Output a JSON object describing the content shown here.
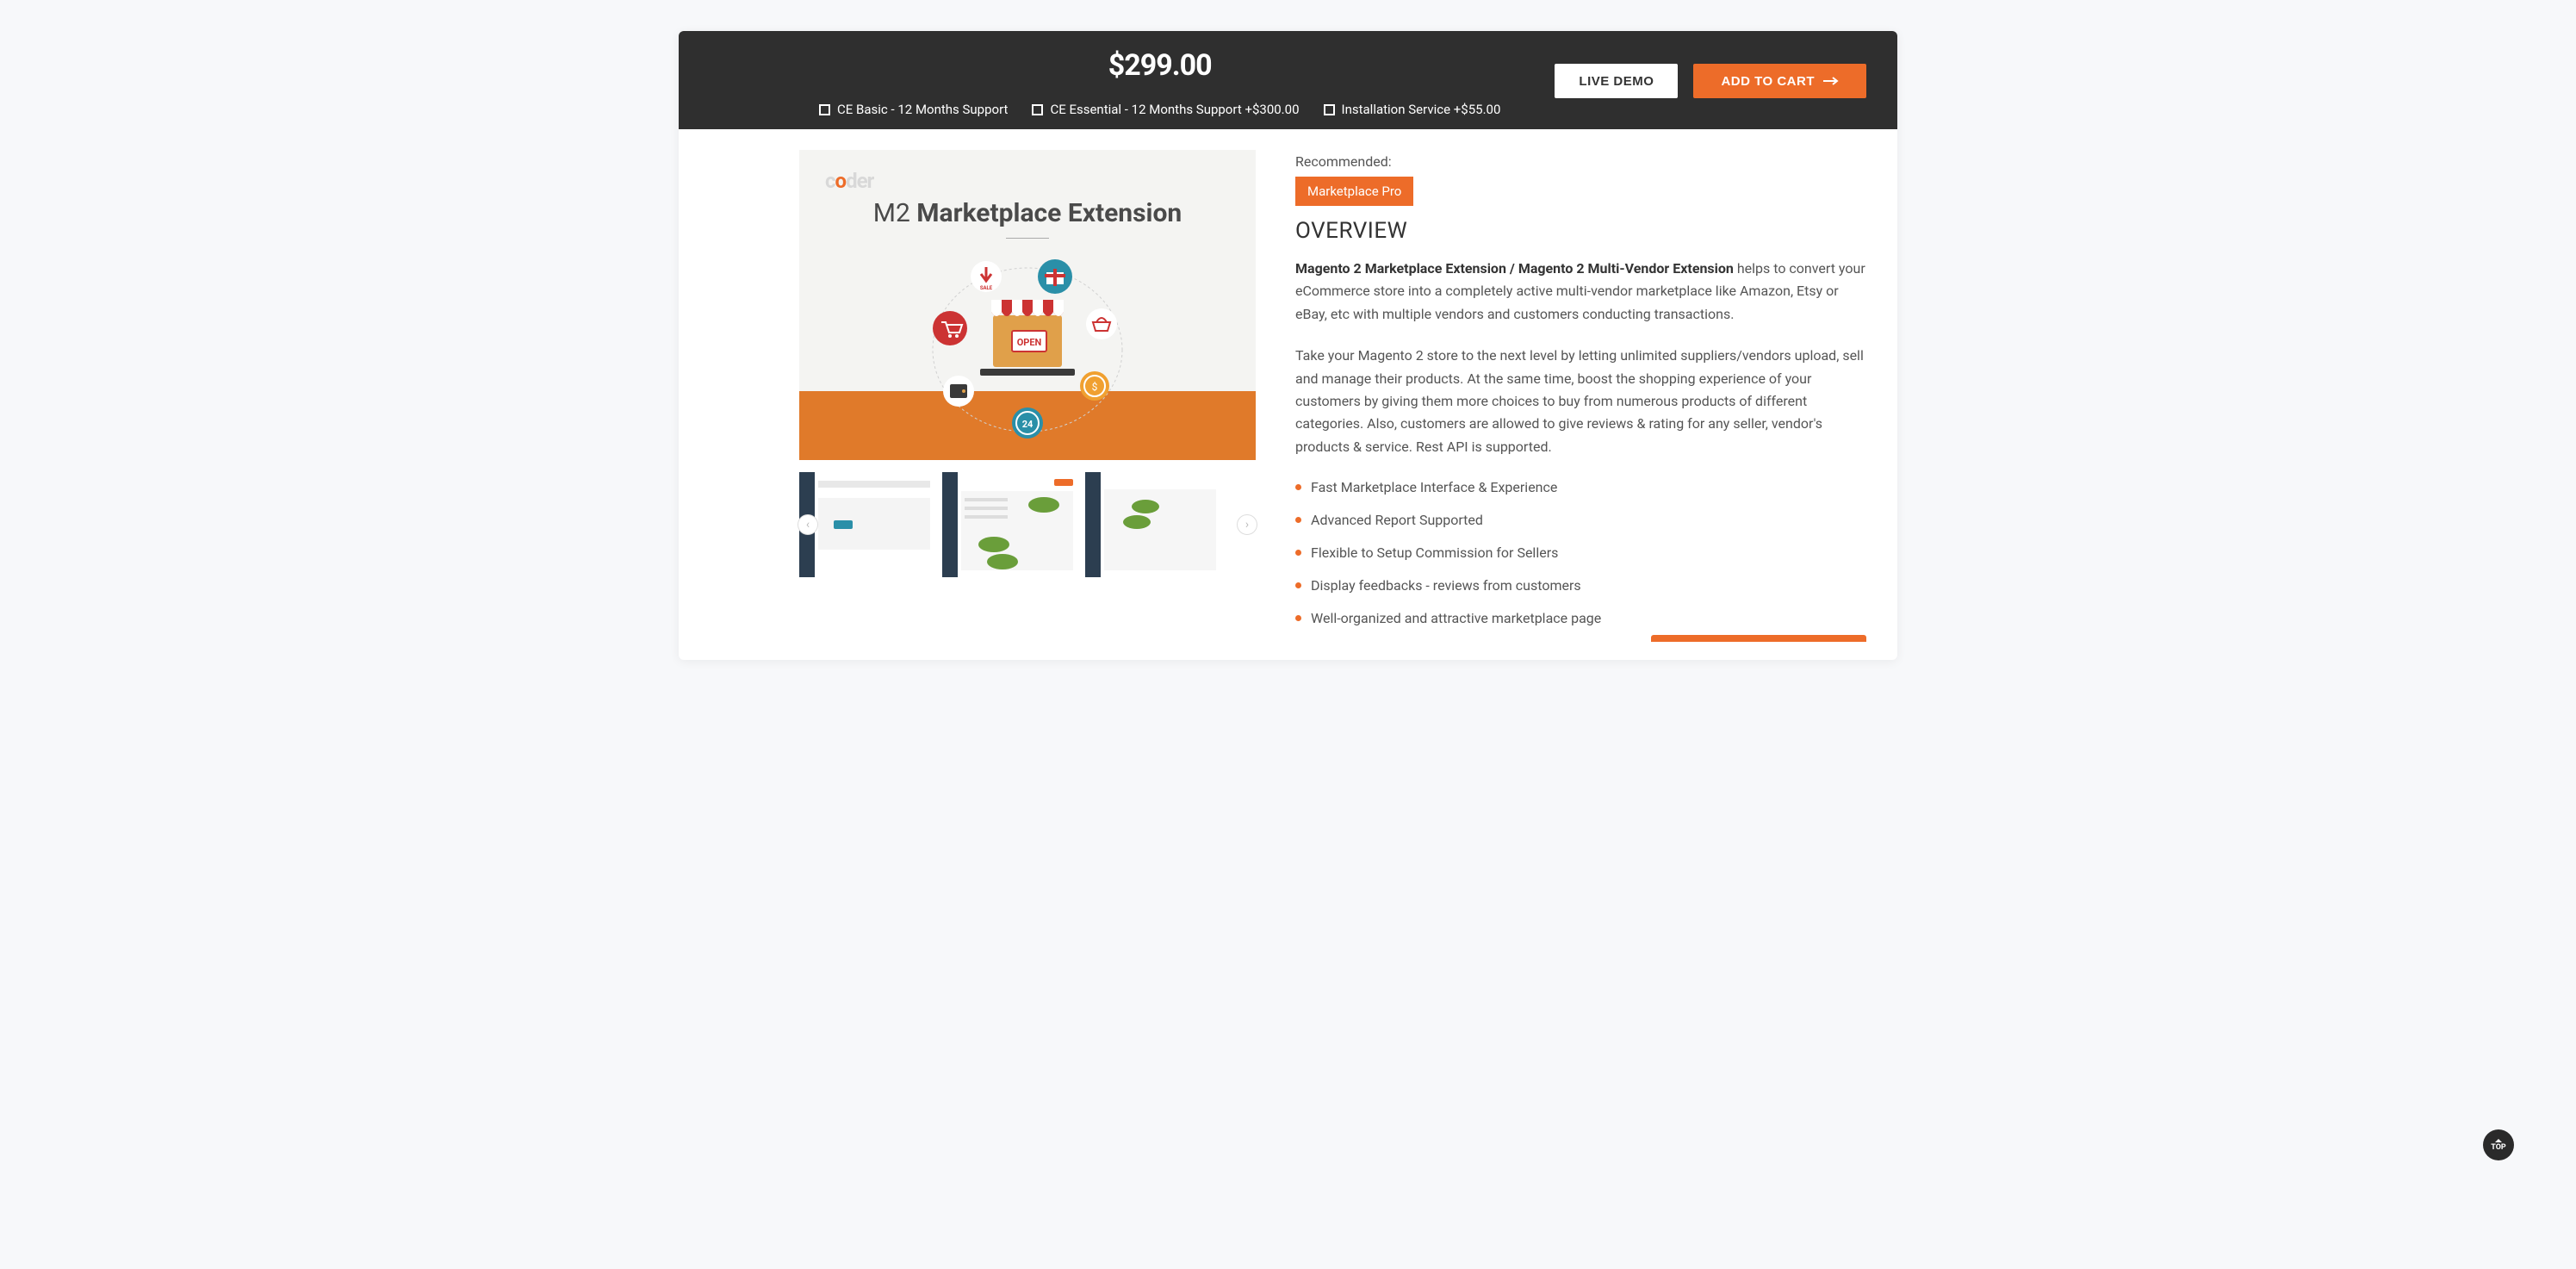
{
  "topbar": {
    "price": "$299.00",
    "options": [
      {
        "label": "CE Basic - 12 Months Support",
        "extra": ""
      },
      {
        "label": "CE Essential - 12 Months Support ",
        "extra": "+$300.00"
      },
      {
        "label": "Installation Service ",
        "extra": "+$55.00"
      }
    ],
    "live_demo": "LIVE DEMO",
    "add_to_cart": "ADD TO CART"
  },
  "hero": {
    "logo_prefix": "c",
    "logo_o": "o",
    "logo_suffix": "der",
    "title_light": "M2 ",
    "title_bold": "Marketplace Extension",
    "open_text": "OPEN",
    "sale_text": "SALE",
    "badge_text": "24"
  },
  "details": {
    "recommended_label": "Recommended:",
    "recommended_pill": "Marketplace Pro",
    "overview_heading": "OVERVIEW",
    "lead_strong": "Magento 2 Marketplace Extension / Magento 2 Multi-Vendor Extension",
    "lead_rest": " helps to convert your eCommerce store into a completely active multi-vendor marketplace like Amazon, Etsy or eBay, etc with multiple vendors and customers conducting transactions.",
    "para2": "Take your Magento 2 store to the next level by letting unlimited suppliers/vendors upload, sell and manage their products. At the same time, boost the shopping experience of your customers by giving them more choices to buy from numerous products of different categories. Also, customers are allowed to give reviews & rating for any seller, vendor's products & service. Rest API is supported.",
    "bullets": [
      "Fast Marketplace Interface & Experience",
      "Advanced Report Supported",
      "Flexible to Setup Commission for Sellers",
      "Display feedbacks - reviews from customers",
      "Well-organized and attractive marketplace page"
    ]
  },
  "top_button": "TOP"
}
